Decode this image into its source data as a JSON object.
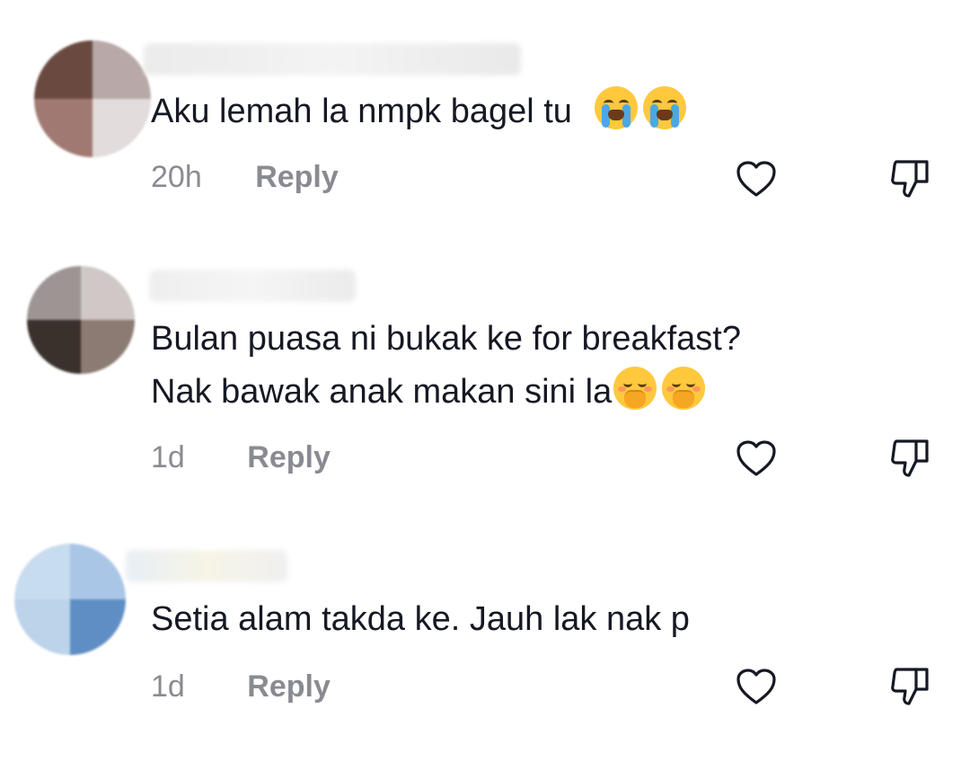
{
  "comments": [
    {
      "text": "Aku lemah la nmpk bagel tu",
      "emojis": [
        "loudly-crying-face",
        "loudly-crying-face"
      ],
      "time": "20h",
      "reply_label": "Reply"
    },
    {
      "text_line1": "Bulan puasa ni bukak ke for breakfast?",
      "text_line2": "Nak bawak anak makan sini la",
      "emojis": [
        "face-with-hand-over-mouth",
        "face-with-hand-over-mouth"
      ],
      "time": "1d",
      "reply_label": "Reply"
    },
    {
      "text": "Setia alam takda ke. Jauh lak nak p",
      "time": "1d",
      "reply_label": "Reply"
    }
  ],
  "icons": {
    "like": "heart-outline-icon",
    "dislike": "thumbs-down-outline-icon"
  },
  "colors": {
    "text": "#161823",
    "meta": "#8a8b91",
    "background": "#ffffff"
  }
}
